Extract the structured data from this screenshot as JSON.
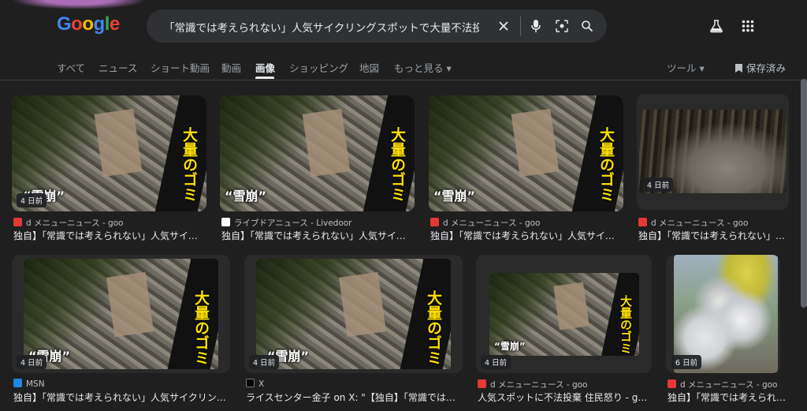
{
  "header": {
    "logo_letters": [
      "G",
      "o",
      "o",
      "g",
      "l",
      "e"
    ],
    "search_query": "「常識では考えられない」人気サイクリングスポットで大量不法投棄 \"",
    "icons": [
      "close-icon",
      "mic-icon",
      "lens-icon",
      "search-icon",
      "labs-flask-icon",
      "apps-grid-icon"
    ]
  },
  "tabs": {
    "items": [
      "すべて",
      "ニュース",
      "ショート動画",
      "動画",
      "画像",
      "ショッピング",
      "地図",
      "もっと見る"
    ],
    "more_arrow": "▾",
    "tools_label": "ツール",
    "saved_label": "保存済み"
  },
  "overlay_text": {
    "gomi": "大量のゴミ",
    "snowslide": "“雪崩”"
  },
  "results": [
    {
      "badge": "4 日前",
      "source": "d メニューニュース - goo",
      "title": "独自】「常識では考えられない」人気サイク…",
      "fav_color": "#e53935"
    },
    {
      "badge": "",
      "source": "ライブドアニュース - Livedoor",
      "title": "独自】「常識では考えられない」人気サイク…",
      "fav_color": "#ffffff"
    },
    {
      "badge": "",
      "source": "d メニューニュース - goo",
      "title": "独自】「常識では考えられない」人気サイク…",
      "fav_color": "#e53935"
    },
    {
      "badge": "4 日前",
      "source": "d メニューニュース - goo",
      "title": "独自】「常識では考えられない」…",
      "fav_color": "#e53935"
    },
    {
      "badge": "4 日前",
      "source": "MSN",
      "title": "独自】「常識では考えられない」人気サイクリン…",
      "fav_color": "#1e88e5"
    },
    {
      "badge": "4 日前",
      "source": "X",
      "title": "ライスセンター金子 on X: \"【独自】「常識では考…",
      "fav_color": "#000000"
    },
    {
      "badge": "4 日前",
      "source": "d メニューニュース - goo",
      "title": "人気スポットに不法投棄 住民怒り - go…",
      "fav_color": "#e53935"
    },
    {
      "badge": "6 日前",
      "source": "d メニューニュース - goo",
      "title": "独自】「常識では考えられ…",
      "fav_color": "#e53935"
    }
  ]
}
